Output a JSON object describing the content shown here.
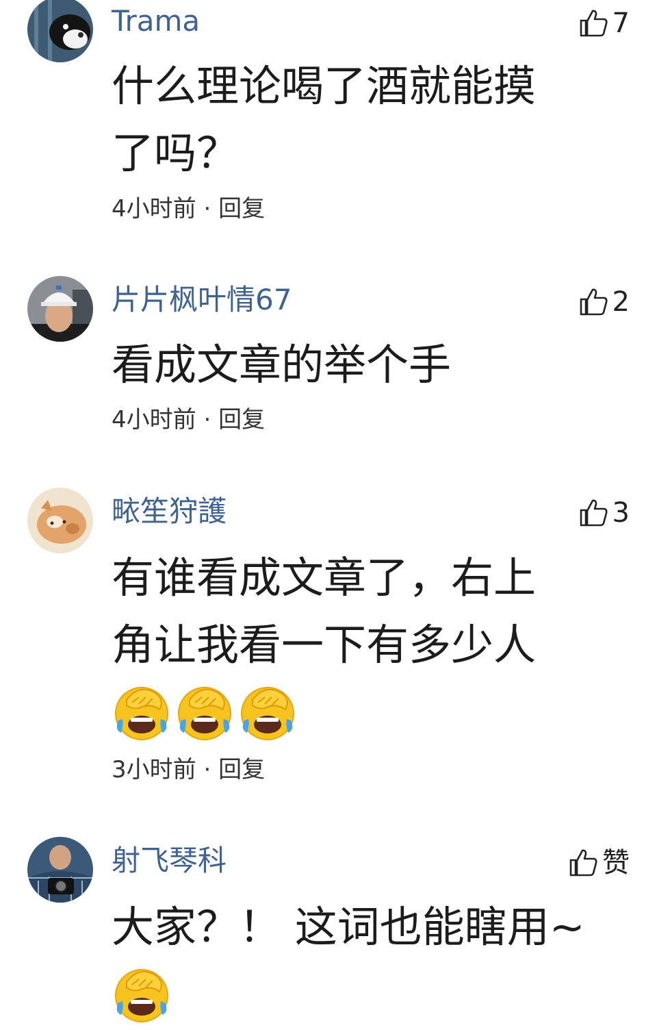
{
  "comments": [
    {
      "username": "Trama",
      "like_count": "7",
      "text_lines": [
        "什么理论喝了酒就能摸",
        "了吗？"
      ],
      "time": "4小时前",
      "separator": " · ",
      "reply_label": "回复",
      "avatar_icon": "avatar-animal-icon"
    },
    {
      "username": "片片枫叶情67",
      "like_count": "2",
      "text_lines": [
        "看成文章的举个手"
      ],
      "time": "4小时前",
      "separator": " · ",
      "reply_label": "回复",
      "avatar_icon": "avatar-person-helmet-icon"
    },
    {
      "username": "畩笙狩護",
      "like_count": "3",
      "text_lines": [
        "有谁看成文章了，右上",
        "角让我看一下有多少人"
      ],
      "emoji": [
        "face-palm-laughing-emoji",
        "face-palm-laughing-emoji",
        "face-palm-laughing-emoji"
      ],
      "time": "3小时前",
      "separator": " · ",
      "reply_label": "回复",
      "avatar_icon": "avatar-cat-icon"
    },
    {
      "username": "射飞琴科",
      "like_count": "赞",
      "text_lines": [
        "大家？！ 这词也能瞎用~"
      ],
      "emoji": [
        "face-palm-laughing-emoji"
      ],
      "avatar_icon": "avatar-person-camera-icon"
    }
  ],
  "colors": {
    "username": "#40628f",
    "text": "#1c1c1c",
    "emoji_face": "#f7c41f"
  }
}
